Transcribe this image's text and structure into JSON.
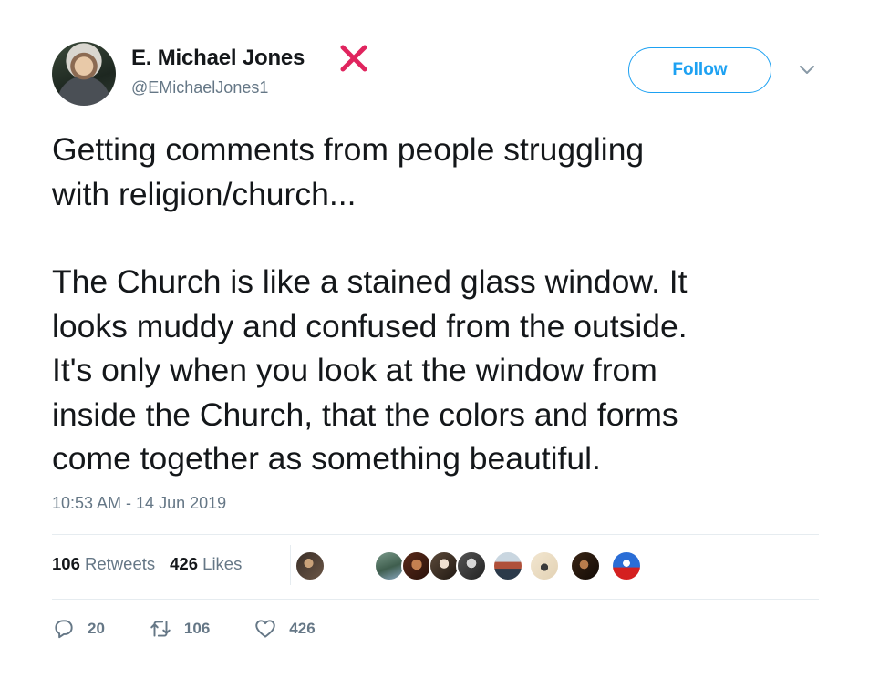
{
  "author": {
    "name": "E. Michael Jones",
    "handle": "@EMichaelJones1"
  },
  "follow_label": "Follow",
  "tweet": {
    "paragraph1": "Getting comments from people struggling\nwith religion/church...",
    "paragraph2": "The Church is like a stained glass window. It\nlooks muddy and confused from the outside.\nIt's only when you look at the window from\ninside the Church, that the colors and forms\ncome together as something beautiful."
  },
  "timestamp": "10:53 AM - 14 Jun 2019",
  "stats": {
    "retweets_count": "106",
    "retweets_label": "Retweets",
    "likes_count": "426",
    "likes_label": "Likes"
  },
  "actions": {
    "replies": "20",
    "retweets": "106",
    "likes": "426"
  },
  "colors": {
    "accent": "#1da1f2",
    "muted": "#657786",
    "text": "#14171a",
    "red_x": "#e0245e"
  },
  "icons": [
    "red-x-icon",
    "chevron-down-icon",
    "reply-icon",
    "retweet-icon",
    "heart-icon"
  ]
}
